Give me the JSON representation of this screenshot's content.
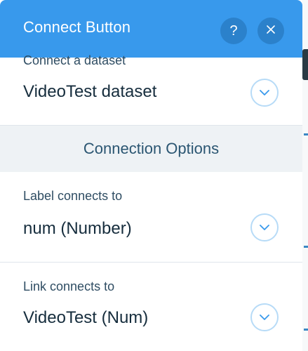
{
  "header": {
    "title": "Connect Button",
    "help_icon": "question-mark-icon",
    "help_glyph": "?",
    "close_icon": "close-icon",
    "close_glyph": "✕"
  },
  "dataset": {
    "label": "Connect a dataset",
    "value": "VideoTest dataset"
  },
  "options": {
    "title": "Connection Options"
  },
  "label_connect": {
    "label": "Label connects to",
    "value": "num (Number)"
  },
  "link_connect": {
    "label": "Link connects to",
    "value": "VideoTest (Num)"
  },
  "colors": {
    "header_bg": "#3899ec",
    "header_button_bg": "#2b81cb",
    "chevron_ring": "#b7dbf7",
    "chevron_stroke": "#3899ec",
    "options_bg": "#eef2f5",
    "text_dark": "#162d3d"
  }
}
